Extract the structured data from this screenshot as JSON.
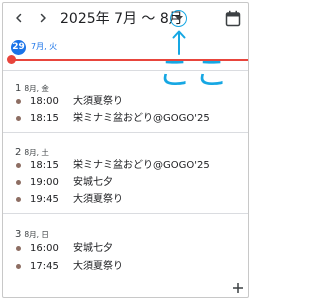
{
  "header": {
    "title": "2025年 7月 ～ 8月"
  },
  "annotation": {
    "text": "ここ",
    "color": "#16a7e3"
  },
  "today": {
    "day": "29",
    "label": "7月, 火"
  },
  "days": [
    {
      "day": "1",
      "sub": "8月, 金",
      "events": [
        {
          "time": "18:00",
          "title": "大須夏祭り"
        },
        {
          "time": "18:15",
          "title": "栄ミナミ盆おどり@GOGO'25"
        }
      ]
    },
    {
      "day": "2",
      "sub": "8月, 土",
      "events": [
        {
          "time": "18:15",
          "title": "栄ミナミ盆おどり@GOGO'25"
        },
        {
          "time": "19:00",
          "title": "安城七夕"
        },
        {
          "time": "19:45",
          "title": "大須夏祭り"
        }
      ]
    },
    {
      "day": "3",
      "sub": "8月, 日",
      "events": [
        {
          "time": "16:00",
          "title": "安城七夕"
        },
        {
          "time": "17:45",
          "title": "大須夏祭り"
        }
      ]
    }
  ],
  "colors": {
    "accent": "#1a73e8",
    "now_line": "#e8453c",
    "event_dot": "#8d6e63",
    "annotation": "#16a7e3"
  },
  "icons": {
    "prev": "chevron-left-icon",
    "next": "chevron-right-icon",
    "dropdown": "caret-down-icon",
    "calendar": "calendar-icon",
    "add": "plus-icon"
  }
}
